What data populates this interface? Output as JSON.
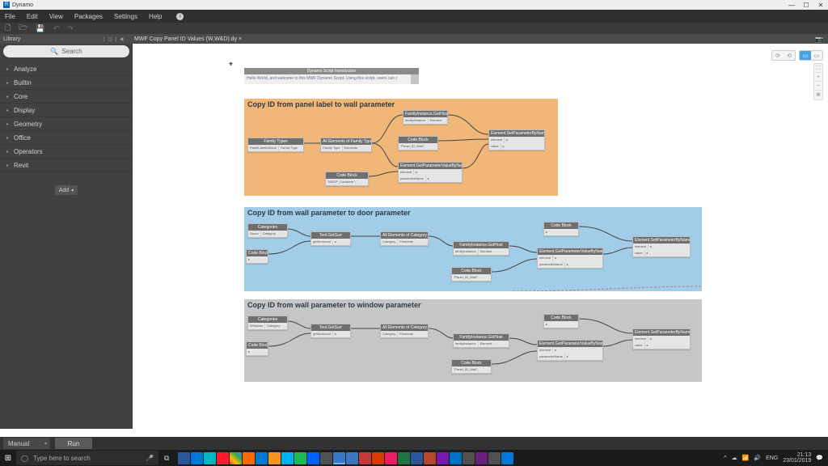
{
  "app": {
    "title": "Dynamo"
  },
  "menu": {
    "file": "File",
    "edit": "Edit",
    "view": "View",
    "packages": "Packages",
    "settings": "Settings",
    "help": "Help"
  },
  "tab": {
    "name": "MWF Copy Panel ID Values (W,W&D).dy"
  },
  "library": {
    "label": "Library",
    "search_placeholder": "Search",
    "categories": [
      "Analyze",
      "Builtin",
      "Core",
      "Display",
      "Geometry",
      "Office",
      "Operators",
      "Revit"
    ],
    "add_label": "Add"
  },
  "groups": {
    "intro": {
      "header": "Dynamo Script Introduction",
      "body": "Hello World, and welcome to this MWF Dynamo Script. Using this script, users can c"
    },
    "orange": {
      "title": "Copy ID from panel label to wall parameter"
    },
    "blue": {
      "title": "Copy ID from wall parameter to door parameter"
    },
    "grey": {
      "title": "Copy ID from wall parameter to window parameter"
    }
  },
  "nodes": {
    "o_ft": {
      "title": "Family Types",
      "in": "PanelLabelDefault",
      "out": "Family Type"
    },
    "o_ae": {
      "title": "All Elements of Family Type",
      "in": "Family Type",
      "out": "Elements"
    },
    "o_cb1": {
      "title": "Code Block",
      "body": "\"MSGF_Container\";"
    },
    "o_cb2": {
      "title": "Code Block",
      "body": "\"Panel_ID_Wall\";"
    },
    "o_fis": {
      "title": "FamilyInstance.GetHost"
    },
    "o_gpv": {
      "title": "Element.GetParameterValueByName"
    },
    "o_spv": {
      "title": "Element.SetParameterByName"
    },
    "cat": {
      "title": "Categories",
      "in": "Doors",
      "out": "Category"
    },
    "catw": {
      "title": "Categories",
      "in": "Windows",
      "out": "Category"
    },
    "tp": {
      "title": "Tool.GetSurr",
      "body": "getSurround"
    },
    "aec": {
      "title": "All Elements of Category",
      "in": "Category",
      "out": "Elements"
    },
    "cb3": {
      "title": "Code Block",
      "body": "\"Panel_ID_Wall\";"
    },
    "cb4": {
      "title": "Code Block"
    },
    "fis": {
      "title": "FamilyInstance.GetHost"
    },
    "gpv": {
      "title": "Element.GetParameterValueByName"
    },
    "spv": {
      "title": "Element.SetParameterByName"
    }
  },
  "run": {
    "mode": "Manual",
    "button": "Run"
  },
  "win": {
    "search_placeholder": "Type here to search",
    "lang": "ENG",
    "time": "21:13",
    "date": "23/01/2019"
  }
}
